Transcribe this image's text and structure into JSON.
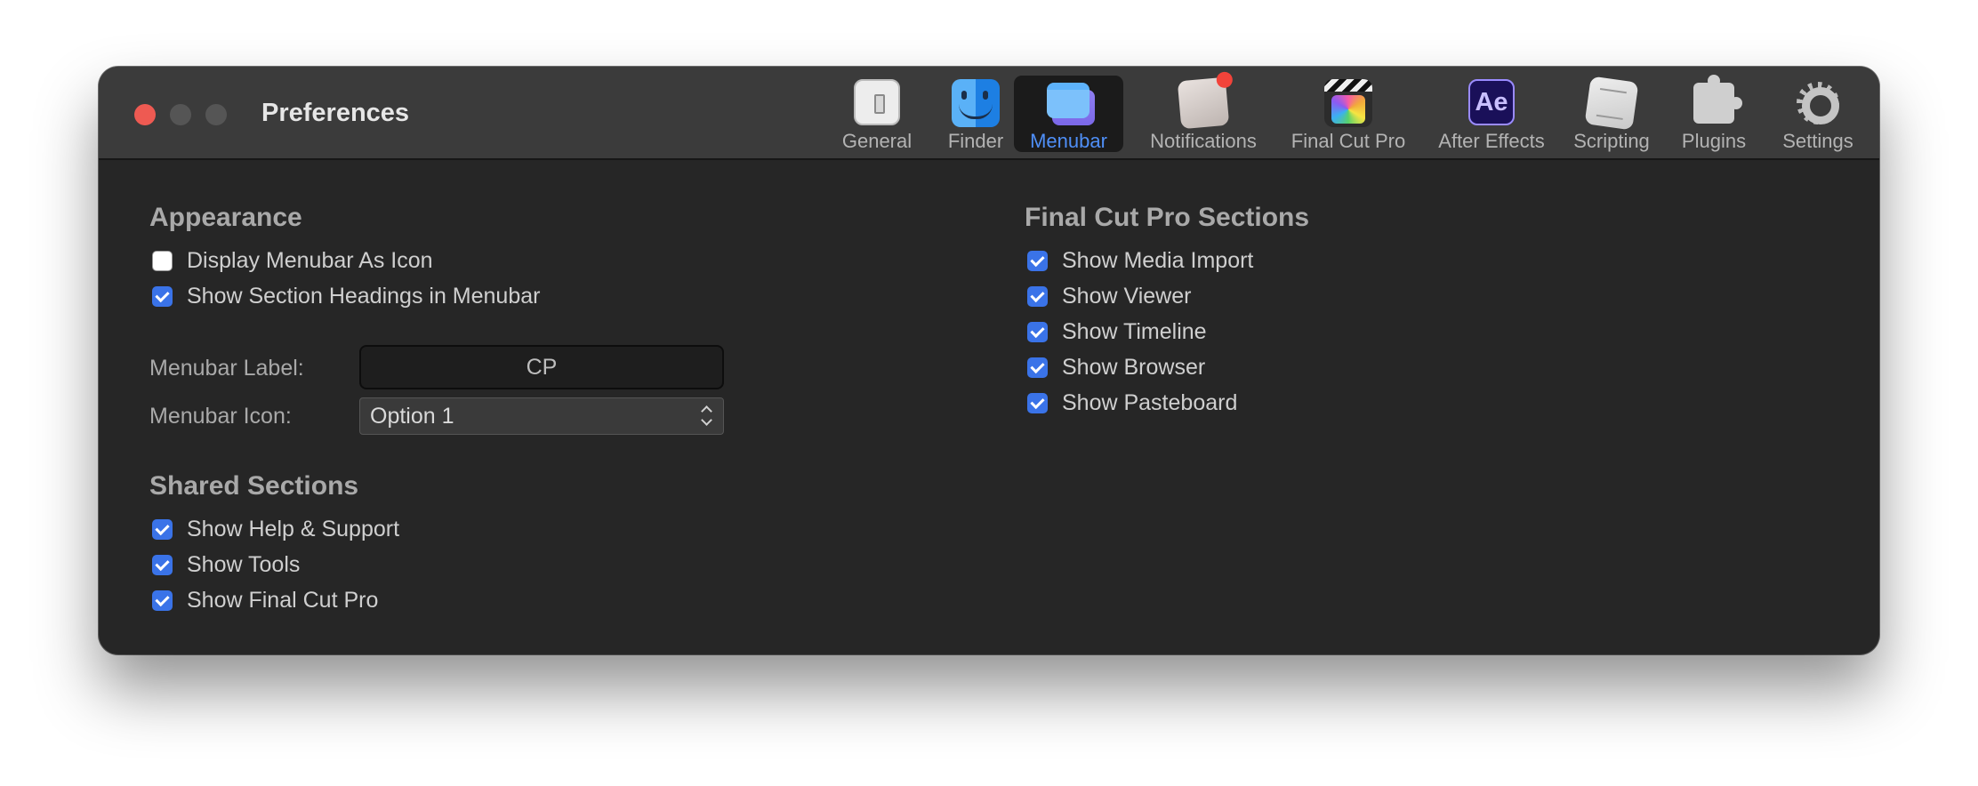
{
  "window": {
    "title": "Preferences"
  },
  "toolbar": {
    "items": [
      {
        "label": "General",
        "icon": "general-icon"
      },
      {
        "label": "Finder",
        "icon": "finder-icon"
      },
      {
        "label": "Menubar",
        "icon": "menubar-icon",
        "selected": true
      },
      {
        "label": "Notifications",
        "icon": "notifications-icon"
      },
      {
        "label": "Final Cut Pro",
        "icon": "final-cut-pro-icon"
      },
      {
        "label": "After Effects",
        "icon": "after-effects-icon",
        "icon_text": "Ae"
      },
      {
        "label": "Scripting",
        "icon": "scripting-icon"
      },
      {
        "label": "Plugins",
        "icon": "plugins-icon"
      },
      {
        "label": "Settings",
        "icon": "settings-icon"
      }
    ]
  },
  "appearance": {
    "title": "Appearance",
    "options": [
      {
        "label": "Display Menubar As Icon",
        "checked": false
      },
      {
        "label": "Show Section Headings in Menubar",
        "checked": true
      }
    ],
    "menubar_label": {
      "label": "Menubar Label:",
      "value": "CP"
    },
    "menubar_icon": {
      "label": "Menubar Icon:",
      "value": "Option 1"
    }
  },
  "shared_sections": {
    "title": "Shared Sections",
    "options": [
      {
        "label": "Show Help & Support",
        "checked": true
      },
      {
        "label": "Show Tools",
        "checked": true
      },
      {
        "label": "Show Final Cut Pro",
        "checked": true
      }
    ]
  },
  "fcp_sections": {
    "title": "Final Cut Pro Sections",
    "options": [
      {
        "label": "Show Media Import",
        "checked": true
      },
      {
        "label": "Show Viewer",
        "checked": true
      },
      {
        "label": "Show Timeline",
        "checked": true
      },
      {
        "label": "Show Browser",
        "checked": true
      },
      {
        "label": "Show Pasteboard",
        "checked": true
      }
    ]
  },
  "colors": {
    "window_bg": "#262626",
    "titlebar_bg": "#3b3b3b",
    "accent": "#3a73e8",
    "selected_label": "#4f8ff7",
    "close_button": "#ee5a52"
  }
}
